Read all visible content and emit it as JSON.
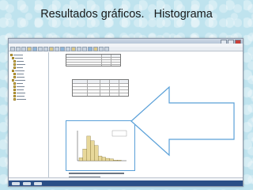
{
  "slide": {
    "title": "Resultados gráficos.   Histograma"
  },
  "window": {
    "title_text": "",
    "menu": [],
    "theme": {
      "accent": "#5aa0d8",
      "taskbar": "#2a4f86",
      "bar_fill": "#e8d89a",
      "bar_stroke": "#6b5b1e",
      "arrow_fill": "#ffffff",
      "arrow_stroke": "#5aa0d8"
    }
  },
  "output": {
    "table_heading": "",
    "chart_box_caption": ""
  },
  "chart_data": {
    "type": "bar",
    "title": "",
    "xlabel": "",
    "ylabel": "",
    "categories": [
      "1",
      "2",
      "3",
      "4",
      "5",
      "6",
      "7",
      "8",
      "9",
      "10",
      "11",
      "12"
    ],
    "values": [
      5,
      20,
      42,
      34,
      26,
      8,
      6,
      4,
      3,
      1,
      1,
      0
    ],
    "ylim": [
      0,
      50
    ],
    "grid": false,
    "legend": "top-right"
  }
}
